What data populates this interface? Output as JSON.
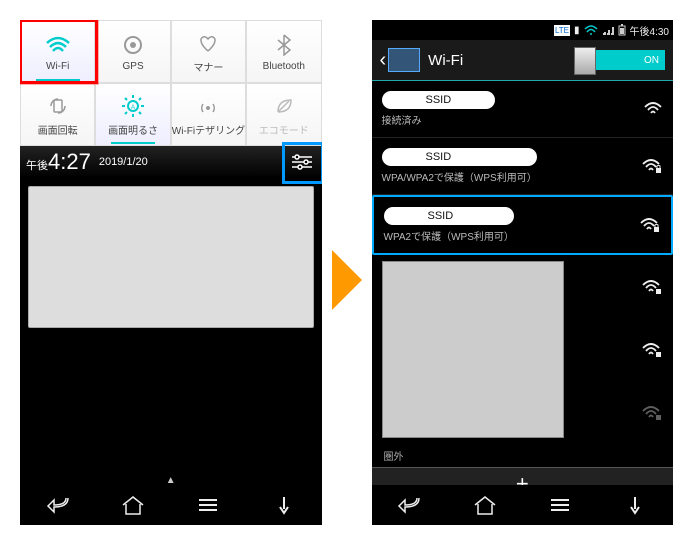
{
  "left": {
    "tiles": [
      {
        "label": "Wi-Fi"
      },
      {
        "label": "GPS"
      },
      {
        "label": "マナー"
      },
      {
        "label": "Bluetooth"
      },
      {
        "label": "画面回転"
      },
      {
        "label": "画面明るさ"
      },
      {
        "label": "Wi-Fiテザリング"
      },
      {
        "label": "エコモード"
      }
    ],
    "time_prefix": "午後",
    "time": "4:27",
    "date": "2019/1/20"
  },
  "right": {
    "status_time": "午後4:30",
    "title": "Wi-Fi",
    "toggle": "ON",
    "networks": [
      {
        "ssid": "SSID",
        "sub": "接続済み",
        "lock": false
      },
      {
        "ssid": "SSID",
        "sub": "WPA/WPA2で保護（WPS利用可）",
        "lock": true
      },
      {
        "ssid": "SSID",
        "sub": "WPA2で保護（WPS利用可）",
        "lock": true,
        "hl": true
      }
    ],
    "out_of_range": "圏外",
    "add": "+"
  }
}
